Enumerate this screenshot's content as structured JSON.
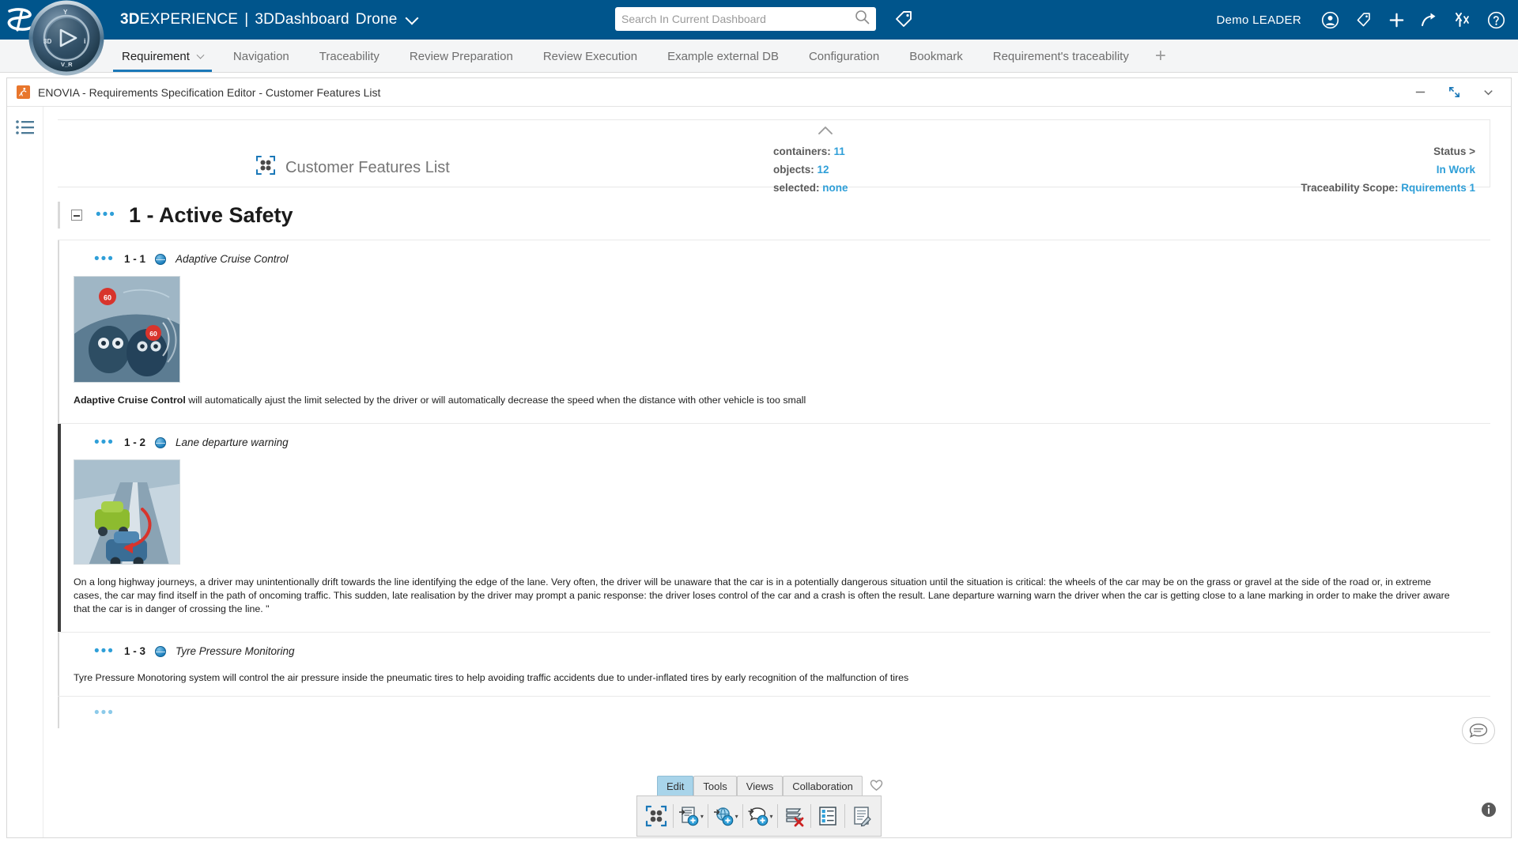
{
  "header": {
    "brand_bold": "3D",
    "brand_rest": "EXPERIENCE",
    "separator": "|",
    "dashboard": "3DDashboard",
    "workspace": "Drone",
    "user": "Demo LEADER",
    "icons": {
      "compass": "compass-icon",
      "search": "search-icon",
      "tag": "tag-icon",
      "user": "user-avatar-icon",
      "label": "label-icon",
      "plus": "plus-icon",
      "share": "share-arrow-icon",
      "tools": "tools-icon",
      "help": "help-icon"
    },
    "accent_color": "#00558c"
  },
  "search": {
    "placeholder": "Search In Current Dashboard",
    "value": ""
  },
  "tabs": [
    {
      "label": "Requirement",
      "active": true,
      "has_chevron": true
    },
    {
      "label": "Navigation",
      "active": false,
      "has_chevron": false
    },
    {
      "label": "Traceability",
      "active": false,
      "has_chevron": false
    },
    {
      "label": "Review Preparation",
      "active": false,
      "has_chevron": false
    },
    {
      "label": "Review Execution",
      "active": false,
      "has_chevron": false
    },
    {
      "label": "Example external DB",
      "active": false,
      "has_chevron": false
    },
    {
      "label": "Configuration",
      "active": false,
      "has_chevron": false
    },
    {
      "label": "Bookmark",
      "active": false,
      "has_chevron": false
    },
    {
      "label": "Requirement's traceability",
      "active": false,
      "has_chevron": false
    }
  ],
  "tab_add_label": "+",
  "app_window": {
    "title": "ENOVIA - Requirements Specification Editor - Customer Features List",
    "controls": {
      "minimize": "minimize-icon",
      "restore": "restore-icon",
      "more": "chevron-down-icon"
    }
  },
  "doc_header": {
    "title": "Customer Features List",
    "counts": [
      {
        "label": "containers:",
        "value": "11"
      },
      {
        "label": "objects:",
        "value": "12"
      },
      {
        "label": "selected:",
        "value": "none"
      }
    ],
    "status_label": "Status >",
    "status_value": "In Work",
    "traceability_label": "Traceability Scope:",
    "traceability_value": "Rquirements 1",
    "link_color": "#2f9fd8"
  },
  "section": {
    "number_title": "1 - Active Safety"
  },
  "requirements": [
    {
      "number": "1 - 1",
      "name": "Adaptive Cruise Control",
      "has_image": true,
      "image_alt": "car-interior-radar-illustration",
      "body_bold": "Adaptive Cruise Control",
      "body": " will automatically ajust the limit selected by the driver or will automatically decrease the speed when the distance with other vehicle is too small",
      "accent": "light"
    },
    {
      "number": "1 - 2",
      "name": "Lane departure warning",
      "has_image": true,
      "image_alt": "lane-departure-road-illustration",
      "body_bold": "",
      "body": "On a long highway journeys, a driver may unintentionally drift towards the line identifying the edge of the lane. Very often, the driver will be unaware that the car is in a potentially dangerous situation until the situation is critical: the wheels of the car may be on the grass or gravel at the side of the road or, in extreme cases, the car may find itself in the path of oncoming traffic. This sudden, late realisation by the driver may prompt a panic response: the driver loses control of the car and a crash is often the result. Lane departure warning  warn the driver when the car is getting close to a lane marking in order to make the driver aware that the car is in danger of crossing the line. \"",
      "accent": "dark"
    },
    {
      "number": "1 - 3",
      "name": "Tyre Pressure Monitoring",
      "has_image": false,
      "image_alt": "",
      "body_bold": "",
      "body": "Tyre Pressure Monotoring system will control the air pressure inside the pneumatic tires to help avoiding traffic accidents due to under-inflated tires by early recognition of the malfunction of tires",
      "accent": "light"
    }
  ],
  "bottom_toolbar": {
    "tabs": [
      {
        "label": "Edit",
        "active": true
      },
      {
        "label": "Tools",
        "active": false
      },
      {
        "label": "Views",
        "active": false
      },
      {
        "label": "Collaboration",
        "active": false
      }
    ],
    "favorite_icon": "heart-icon",
    "buttons": [
      {
        "name": "select-specification-icon",
        "has_caret": false
      },
      {
        "name": "new-requirement-icon",
        "has_caret": true
      },
      {
        "name": "new-requirement-spec-icon",
        "has_caret": true
      },
      {
        "name": "new-comment-icon",
        "has_caret": true
      },
      {
        "name": "delete-requirement-icon",
        "has_caret": false
      },
      {
        "name": "properties-list-icon",
        "has_caret": false
      },
      {
        "name": "report-icon",
        "has_caret": false
      }
    ]
  },
  "float_buttons": {
    "chat": "chat-bubble-icon",
    "info": "info-icon"
  }
}
